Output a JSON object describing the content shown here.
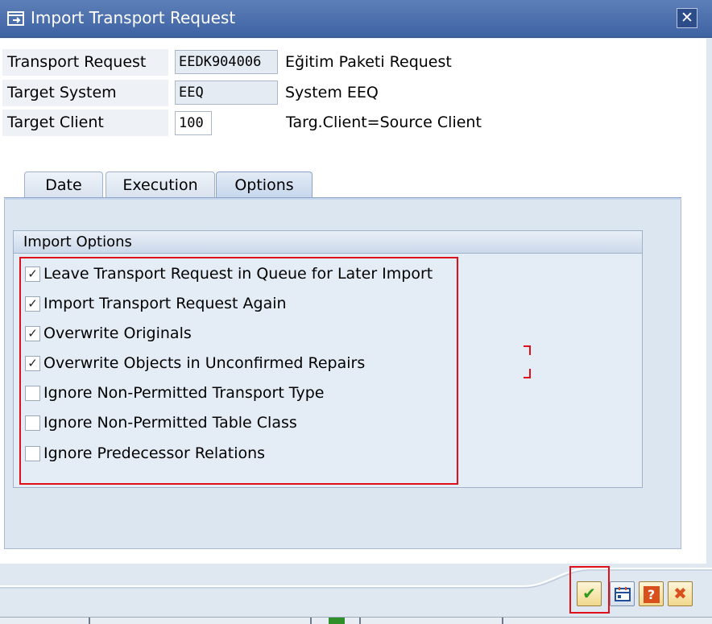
{
  "window": {
    "title": "Import Transport Request",
    "close_glyph": "✕"
  },
  "fields": {
    "transport_request": {
      "label": "Transport Request",
      "value": "EEDK904006",
      "description": "Eğitim Paketi Request"
    },
    "target_system": {
      "label": "Target System",
      "value": "EEQ",
      "description": "System EEQ"
    },
    "target_client": {
      "label": "Target Client",
      "value": "100",
      "description": "Targ.Client=Source Client"
    }
  },
  "tabs": [
    {
      "label": "Date",
      "active": false
    },
    {
      "label": "Execution",
      "active": false
    },
    {
      "label": "Options",
      "active": true
    }
  ],
  "import_options": {
    "title": "Import Options",
    "items": [
      {
        "label": "Leave Transport Request in Queue for Later Import",
        "checked": true
      },
      {
        "label": "Import Transport Request Again",
        "checked": true
      },
      {
        "label": "Overwrite Originals",
        "checked": true
      },
      {
        "label": "Overwrite Objects in Unconfirmed Repairs",
        "checked": true
      },
      {
        "label": "Ignore Non-Permitted Transport Type",
        "checked": false
      },
      {
        "label": "Ignore Non-Permitted Table Class",
        "checked": false
      },
      {
        "label": "Ignore Predecessor Relations",
        "checked": false
      }
    ]
  },
  "checkmark_glyph": "✓",
  "buttons": {
    "confirm": {
      "icon": "checkmark-icon",
      "glyph": "✔",
      "color": "#2f9a1c"
    },
    "schedule": {
      "icon": "calendar-icon",
      "color": "#1f4f9c"
    },
    "help": {
      "icon": "help-icon",
      "glyph": "?",
      "color": "#d8501b"
    },
    "cancel": {
      "icon": "cancel-icon",
      "glyph": "✖",
      "color": "#d8501b"
    }
  },
  "colors": {
    "titlebar": "#3e63a3",
    "highlight_frame": "#e0101a"
  }
}
